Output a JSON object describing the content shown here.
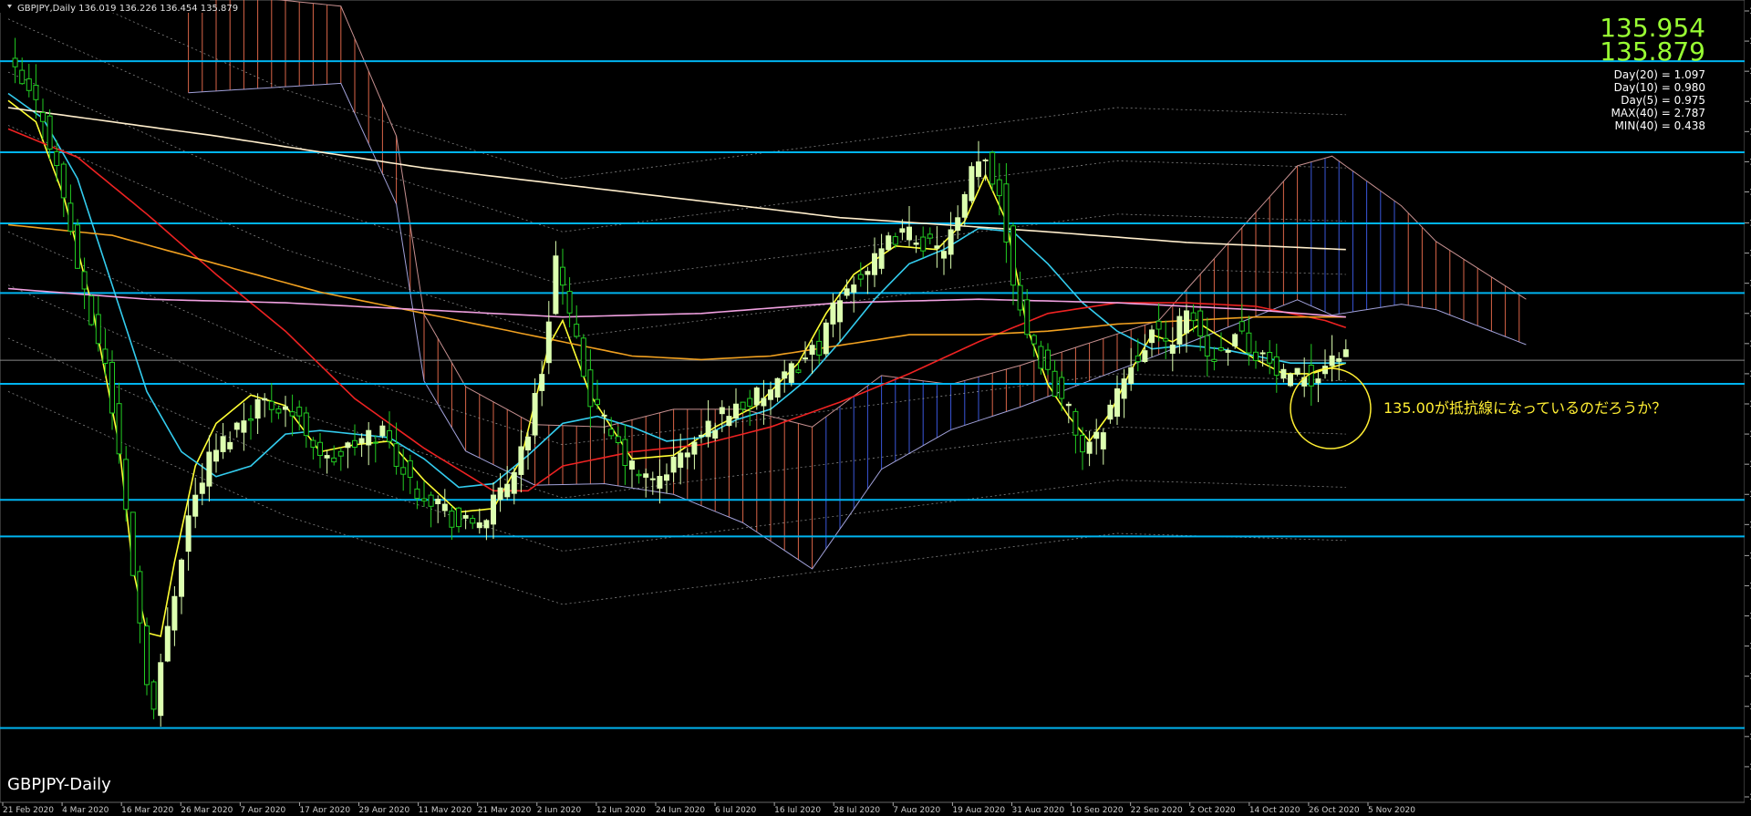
{
  "window": {
    "header": "GBPJPY,Daily  136.019 136.226 136.454 135.879",
    "watermark": "GBPJPY-Daily"
  },
  "quotes": {
    "bid": "135.954",
    "ask": "135.879"
  },
  "stats": [
    "Day(20) = 1.097",
    "Day(10) = 0.980",
    "Day(5) = 0.975",
    "MAX(40) = 2.787",
    "MIN(40) = 0.438"
  ],
  "annotation": "135.00が抵抗線になっているのだろうか？",
  "colors": {
    "background": "#000000",
    "bull_candle": "#ddffb0",
    "bear_candle": "#22cc22",
    "hline": "#00b4f0",
    "ma_yellow": "#ffff33",
    "ma_cyan": "#33ccee",
    "ma_red": "#ee2222",
    "ma_orange": "#f0a020",
    "ma_pink": "#f0a0e0",
    "ma_white": "#ffeecc",
    "cloud_bull": "#4466ff",
    "cloud_bear": "#ff7755",
    "quote_text": "#99ff33"
  },
  "chart_data": {
    "type": "candlestick",
    "symbol": "GBPJPY",
    "timeframe": "Daily",
    "ylim": [
      123.6,
      146.0
    ],
    "y_ticks": [
      "145.725",
      "144.875",
      "144.025",
      "143.175",
      "142.325",
      "141.475",
      "140.625",
      "139.750",
      "138.900",
      "138.050",
      "137.200",
      "136.350",
      "135.500",
      "134.650",
      "133.800",
      "132.950",
      "132.100",
      "131.250",
      "130.375",
      "129.525",
      "128.675",
      "127.825",
      "126.975",
      "126.125",
      "125.275",
      "124.425",
      "123.575"
    ],
    "x_labels": [
      "21 Feb 2020",
      "4 Mar 2020",
      "16 Mar 2020",
      "26 Mar 2020",
      "7 Apr 2020",
      "17 Apr 2020",
      "29 Apr 2020",
      "11 May 2020",
      "21 May 2020",
      "2 Jun 2020",
      "12 Jun 2020",
      "24 Jun 2020",
      "6 Jul 2020",
      "16 Jul 2020",
      "28 Jul 2020",
      "7 Aug 2020",
      "19 Aug 2020",
      "31 Aug 2020",
      "10 Sep 2020",
      "22 Sep 2020",
      "2 Oct 2020",
      "14 Oct 2020",
      "26 Oct 2020",
      "5 Nov 2020"
    ],
    "horizontal_lines": [
      {
        "price": 144.31,
        "label": "144.310"
      },
      {
        "price": 141.743,
        "label": "141.743"
      },
      {
        "price": 139.737,
        "label": "139.737"
      },
      {
        "price": 137.775,
        "label": "137.775"
      },
      {
        "price": 135.214,
        "label": "135.214"
      },
      {
        "price": 131.947,
        "label": "131.947"
      },
      {
        "price": 130.915,
        "label": "130.915"
      },
      {
        "price": 125.515,
        "label": "125.515"
      }
    ],
    "current_price": {
      "price": 135.879,
      "label": "135.879"
    },
    "anchors": [
      [
        0,
        144.2
      ],
      [
        5,
        142.8
      ],
      [
        8,
        140.5
      ],
      [
        11,
        137.6
      ],
      [
        14,
        135.8
      ],
      [
        16,
        133.2
      ],
      [
        18,
        130.0
      ],
      [
        20,
        127.0
      ],
      [
        21,
        126.0
      ],
      [
        23,
        128.4
      ],
      [
        26,
        131.5
      ],
      [
        29,
        133.1
      ],
      [
        32,
        133.8
      ],
      [
        36,
        134.7
      ],
      [
        40,
        134.6
      ],
      [
        43,
        133.9
      ],
      [
        46,
        133.0
      ],
      [
        50,
        133.5
      ],
      [
        54,
        133.9
      ],
      [
        58,
        132.4
      ],
      [
        62,
        131.9
      ],
      [
        65,
        131.2
      ],
      [
        67,
        131.3
      ],
      [
        69,
        131.5
      ],
      [
        72,
        132.4
      ],
      [
        75,
        133.9
      ],
      [
        77,
        135.6
      ],
      [
        79,
        138.8
      ],
      [
        81,
        137.0
      ],
      [
        84,
        134.8
      ],
      [
        87,
        133.7
      ],
      [
        90,
        132.8
      ],
      [
        93,
        132.4
      ],
      [
        96,
        133.0
      ],
      [
        99,
        133.5
      ],
      [
        102,
        134.2
      ],
      [
        105,
        134.6
      ],
      [
        108,
        134.8
      ],
      [
        111,
        135.1
      ],
      [
        114,
        135.8
      ],
      [
        117,
        136.3
      ],
      [
        119,
        137.2
      ],
      [
        122,
        138.2
      ],
      [
        125,
        138.6
      ],
      [
        128,
        139.4
      ],
      [
        131,
        139.4
      ],
      [
        134,
        138.9
      ],
      [
        137,
        139.7
      ],
      [
        139,
        141.1
      ],
      [
        141,
        141.5
      ],
      [
        143,
        140.6
      ],
      [
        145,
        138.2
      ],
      [
        147,
        136.7
      ],
      [
        150,
        135.5
      ],
      [
        153,
        134.4
      ],
      [
        155,
        133.4
      ],
      [
        157,
        133.6
      ],
      [
        159,
        134.6
      ],
      [
        162,
        135.8
      ],
      [
        165,
        136.7
      ],
      [
        167,
        136.3
      ],
      [
        169,
        136.9
      ],
      [
        171,
        137.1
      ],
      [
        173,
        136.0
      ],
      [
        175,
        136.1
      ],
      [
        177,
        136.8
      ],
      [
        179,
        136.3
      ],
      [
        181,
        136.0
      ],
      [
        183,
        135.5
      ],
      [
        185,
        135.2
      ],
      [
        187,
        135.5
      ],
      [
        189,
        135.4
      ],
      [
        191,
        136.1
      ],
      [
        193,
        135.9
      ]
    ],
    "series": [
      {
        "name": "MA-yellow",
        "color": "#ffff33",
        "anchors": [
          [
            0,
            143.2
          ],
          [
            4,
            142.6
          ],
          [
            8,
            140.5
          ],
          [
            12,
            137.5
          ],
          [
            16,
            133.5
          ],
          [
            18,
            130.0
          ],
          [
            20,
            128.2
          ],
          [
            22,
            128.1
          ],
          [
            24,
            130.2
          ],
          [
            27,
            132.9
          ],
          [
            30,
            134.1
          ],
          [
            35,
            134.9
          ],
          [
            40,
            134.6
          ],
          [
            45,
            133.3
          ],
          [
            50,
            133.5
          ],
          [
            55,
            133.6
          ],
          [
            60,
            132.5
          ],
          [
            65,
            131.6
          ],
          [
            70,
            131.7
          ],
          [
            74,
            133.1
          ],
          [
            78,
            136.3
          ],
          [
            80,
            137.0
          ],
          [
            84,
            134.9
          ],
          [
            90,
            133.1
          ],
          [
            96,
            133.2
          ],
          [
            102,
            134.0
          ],
          [
            108,
            134.6
          ],
          [
            114,
            135.8
          ],
          [
            118,
            137.2
          ],
          [
            122,
            138.3
          ],
          [
            128,
            139.1
          ],
          [
            134,
            139.0
          ],
          [
            138,
            139.8
          ],
          [
            141,
            141.1
          ],
          [
            144,
            139.8
          ],
          [
            147,
            136.8
          ],
          [
            150,
            135.2
          ],
          [
            153,
            134.3
          ],
          [
            156,
            133.6
          ],
          [
            159,
            134.4
          ],
          [
            162,
            135.6
          ],
          [
            165,
            136.6
          ],
          [
            168,
            136.4
          ],
          [
            172,
            136.9
          ],
          [
            176,
            136.4
          ],
          [
            180,
            135.9
          ],
          [
            184,
            135.5
          ],
          [
            188,
            135.5
          ],
          [
            193,
            135.8
          ]
        ]
      },
      {
        "name": "MA-cyan",
        "color": "#33ccee",
        "anchors": [
          [
            0,
            143.4
          ],
          [
            5,
            142.7
          ],
          [
            10,
            141.0
          ],
          [
            15,
            138.0
          ],
          [
            20,
            135.0
          ],
          [
            25,
            133.3
          ],
          [
            30,
            132.6
          ],
          [
            35,
            132.9
          ],
          [
            40,
            133.8
          ],
          [
            45,
            133.9
          ],
          [
            50,
            133.8
          ],
          [
            55,
            133.7
          ],
          [
            60,
            133.1
          ],
          [
            65,
            132.3
          ],
          [
            70,
            132.4
          ],
          [
            75,
            133.2
          ],
          [
            80,
            134.1
          ],
          [
            85,
            134.3
          ],
          [
            90,
            134.0
          ],
          [
            95,
            133.6
          ],
          [
            100,
            133.7
          ],
          [
            105,
            134.2
          ],
          [
            110,
            134.5
          ],
          [
            115,
            135.3
          ],
          [
            120,
            136.4
          ],
          [
            125,
            137.6
          ],
          [
            130,
            138.6
          ],
          [
            135,
            139.0
          ],
          [
            140,
            139.6
          ],
          [
            145,
            139.5
          ],
          [
            150,
            138.6
          ],
          [
            155,
            137.5
          ],
          [
            160,
            136.7
          ],
          [
            165,
            136.2
          ],
          [
            170,
            136.3
          ],
          [
            175,
            136.2
          ],
          [
            180,
            136.0
          ],
          [
            185,
            135.8
          ],
          [
            193,
            135.8
          ]
        ]
      },
      {
        "name": "MA-red",
        "color": "#ee2222",
        "anchors": [
          [
            0,
            142.4
          ],
          [
            10,
            141.6
          ],
          [
            20,
            140.0
          ],
          [
            30,
            138.3
          ],
          [
            40,
            136.7
          ],
          [
            50,
            134.8
          ],
          [
            60,
            133.4
          ],
          [
            70,
            132.2
          ],
          [
            75,
            132.2
          ],
          [
            80,
            132.9
          ],
          [
            90,
            133.3
          ],
          [
            100,
            133.5
          ],
          [
            110,
            134.0
          ],
          [
            120,
            134.7
          ],
          [
            130,
            135.5
          ],
          [
            140,
            136.4
          ],
          [
            150,
            137.2
          ],
          [
            160,
            137.5
          ],
          [
            170,
            137.5
          ],
          [
            180,
            137.4
          ],
          [
            190,
            137.0
          ],
          [
            193,
            136.8
          ]
        ]
      },
      {
        "name": "MA-orange",
        "color": "#f0a020",
        "anchors": [
          [
            0,
            139.7
          ],
          [
            15,
            139.4
          ],
          [
            30,
            138.6
          ],
          [
            45,
            137.8
          ],
          [
            60,
            137.2
          ],
          [
            75,
            136.6
          ],
          [
            90,
            136.0
          ],
          [
            100,
            135.9
          ],
          [
            110,
            136.0
          ],
          [
            120,
            136.3
          ],
          [
            130,
            136.6
          ],
          [
            140,
            136.6
          ],
          [
            150,
            136.7
          ],
          [
            160,
            136.9
          ],
          [
            170,
            137.0
          ],
          [
            180,
            137.1
          ],
          [
            193,
            137.1
          ]
        ]
      },
      {
        "name": "MA-pink",
        "color": "#f0a0e0",
        "anchors": [
          [
            0,
            137.9
          ],
          [
            20,
            137.6
          ],
          [
            40,
            137.5
          ],
          [
            60,
            137.3
          ],
          [
            80,
            137.1
          ],
          [
            100,
            137.2
          ],
          [
            120,
            137.5
          ],
          [
            140,
            137.6
          ],
          [
            160,
            137.5
          ],
          [
            180,
            137.3
          ],
          [
            193,
            137.1
          ]
        ]
      },
      {
        "name": "MA-white",
        "color": "#ffeecc",
        "anchors": [
          [
            0,
            143.0
          ],
          [
            30,
            142.2
          ],
          [
            60,
            141.3
          ],
          [
            90,
            140.6
          ],
          [
            120,
            139.9
          ],
          [
            150,
            139.5
          ],
          [
            170,
            139.2
          ],
          [
            193,
            139.0
          ]
        ]
      }
    ]
  }
}
